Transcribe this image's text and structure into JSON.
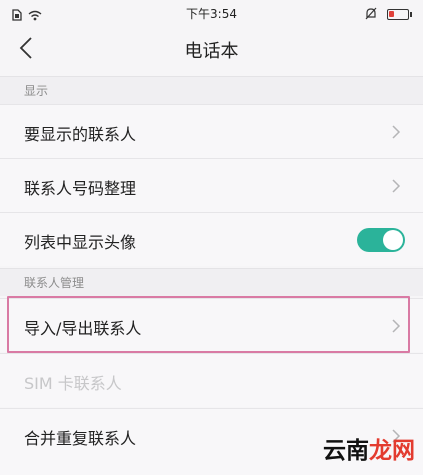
{
  "status_bar": {
    "time": "下午3:54"
  },
  "navbar": {
    "title": "电话本"
  },
  "sections": [
    {
      "header": "显示",
      "rows": [
        {
          "label": "要显示的联系人"
        },
        {
          "label": "联系人号码整理"
        },
        {
          "label": "列表中显示头像",
          "toggle": true
        }
      ]
    },
    {
      "header": "联系人管理",
      "rows": [
        {
          "label": "导入/导出联系人",
          "highlighted": true
        },
        {
          "label": "SIM 卡联系人",
          "disabled": true
        },
        {
          "label": "合并重复联系人"
        }
      ]
    }
  ],
  "watermark": {
    "part1": "云南",
    "part2": "龙网"
  },
  "colors": {
    "accent": "#2bb39a",
    "highlight_border": "#d97aa4",
    "battery_low": "#e0403a"
  },
  "icons": [
    "sim-icon",
    "wifi-icon",
    "bell-muted-icon",
    "battery-icon",
    "back-icon",
    "chevron-right-icon"
  ]
}
